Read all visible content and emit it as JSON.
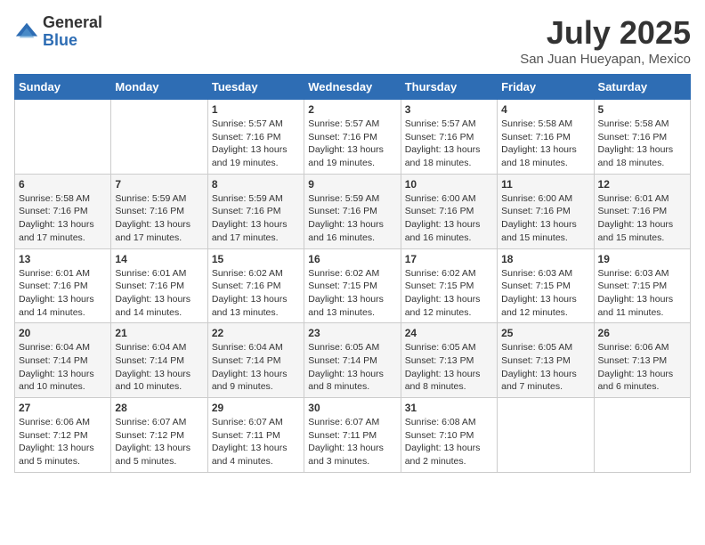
{
  "logo": {
    "general": "General",
    "blue": "Blue"
  },
  "title": {
    "month": "July 2025",
    "location": "San Juan Hueyapan, Mexico"
  },
  "days_of_week": [
    "Sunday",
    "Monday",
    "Tuesday",
    "Wednesday",
    "Thursday",
    "Friday",
    "Saturday"
  ],
  "weeks": [
    [
      {
        "day": "",
        "info": ""
      },
      {
        "day": "",
        "info": ""
      },
      {
        "day": "1",
        "info": "Sunrise: 5:57 AM\nSunset: 7:16 PM\nDaylight: 13 hours and 19 minutes."
      },
      {
        "day": "2",
        "info": "Sunrise: 5:57 AM\nSunset: 7:16 PM\nDaylight: 13 hours and 19 minutes."
      },
      {
        "day": "3",
        "info": "Sunrise: 5:57 AM\nSunset: 7:16 PM\nDaylight: 13 hours and 18 minutes."
      },
      {
        "day": "4",
        "info": "Sunrise: 5:58 AM\nSunset: 7:16 PM\nDaylight: 13 hours and 18 minutes."
      },
      {
        "day": "5",
        "info": "Sunrise: 5:58 AM\nSunset: 7:16 PM\nDaylight: 13 hours and 18 minutes."
      }
    ],
    [
      {
        "day": "6",
        "info": "Sunrise: 5:58 AM\nSunset: 7:16 PM\nDaylight: 13 hours and 17 minutes."
      },
      {
        "day": "7",
        "info": "Sunrise: 5:59 AM\nSunset: 7:16 PM\nDaylight: 13 hours and 17 minutes."
      },
      {
        "day": "8",
        "info": "Sunrise: 5:59 AM\nSunset: 7:16 PM\nDaylight: 13 hours and 17 minutes."
      },
      {
        "day": "9",
        "info": "Sunrise: 5:59 AM\nSunset: 7:16 PM\nDaylight: 13 hours and 16 minutes."
      },
      {
        "day": "10",
        "info": "Sunrise: 6:00 AM\nSunset: 7:16 PM\nDaylight: 13 hours and 16 minutes."
      },
      {
        "day": "11",
        "info": "Sunrise: 6:00 AM\nSunset: 7:16 PM\nDaylight: 13 hours and 15 minutes."
      },
      {
        "day": "12",
        "info": "Sunrise: 6:01 AM\nSunset: 7:16 PM\nDaylight: 13 hours and 15 minutes."
      }
    ],
    [
      {
        "day": "13",
        "info": "Sunrise: 6:01 AM\nSunset: 7:16 PM\nDaylight: 13 hours and 14 minutes."
      },
      {
        "day": "14",
        "info": "Sunrise: 6:01 AM\nSunset: 7:16 PM\nDaylight: 13 hours and 14 minutes."
      },
      {
        "day": "15",
        "info": "Sunrise: 6:02 AM\nSunset: 7:16 PM\nDaylight: 13 hours and 13 minutes."
      },
      {
        "day": "16",
        "info": "Sunrise: 6:02 AM\nSunset: 7:15 PM\nDaylight: 13 hours and 13 minutes."
      },
      {
        "day": "17",
        "info": "Sunrise: 6:02 AM\nSunset: 7:15 PM\nDaylight: 13 hours and 12 minutes."
      },
      {
        "day": "18",
        "info": "Sunrise: 6:03 AM\nSunset: 7:15 PM\nDaylight: 13 hours and 12 minutes."
      },
      {
        "day": "19",
        "info": "Sunrise: 6:03 AM\nSunset: 7:15 PM\nDaylight: 13 hours and 11 minutes."
      }
    ],
    [
      {
        "day": "20",
        "info": "Sunrise: 6:04 AM\nSunset: 7:14 PM\nDaylight: 13 hours and 10 minutes."
      },
      {
        "day": "21",
        "info": "Sunrise: 6:04 AM\nSunset: 7:14 PM\nDaylight: 13 hours and 10 minutes."
      },
      {
        "day": "22",
        "info": "Sunrise: 6:04 AM\nSunset: 7:14 PM\nDaylight: 13 hours and 9 minutes."
      },
      {
        "day": "23",
        "info": "Sunrise: 6:05 AM\nSunset: 7:14 PM\nDaylight: 13 hours and 8 minutes."
      },
      {
        "day": "24",
        "info": "Sunrise: 6:05 AM\nSunset: 7:13 PM\nDaylight: 13 hours and 8 minutes."
      },
      {
        "day": "25",
        "info": "Sunrise: 6:05 AM\nSunset: 7:13 PM\nDaylight: 13 hours and 7 minutes."
      },
      {
        "day": "26",
        "info": "Sunrise: 6:06 AM\nSunset: 7:13 PM\nDaylight: 13 hours and 6 minutes."
      }
    ],
    [
      {
        "day": "27",
        "info": "Sunrise: 6:06 AM\nSunset: 7:12 PM\nDaylight: 13 hours and 5 minutes."
      },
      {
        "day": "28",
        "info": "Sunrise: 6:07 AM\nSunset: 7:12 PM\nDaylight: 13 hours and 5 minutes."
      },
      {
        "day": "29",
        "info": "Sunrise: 6:07 AM\nSunset: 7:11 PM\nDaylight: 13 hours and 4 minutes."
      },
      {
        "day": "30",
        "info": "Sunrise: 6:07 AM\nSunset: 7:11 PM\nDaylight: 13 hours and 3 minutes."
      },
      {
        "day": "31",
        "info": "Sunrise: 6:08 AM\nSunset: 7:10 PM\nDaylight: 13 hours and 2 minutes."
      },
      {
        "day": "",
        "info": ""
      },
      {
        "day": "",
        "info": ""
      }
    ]
  ]
}
